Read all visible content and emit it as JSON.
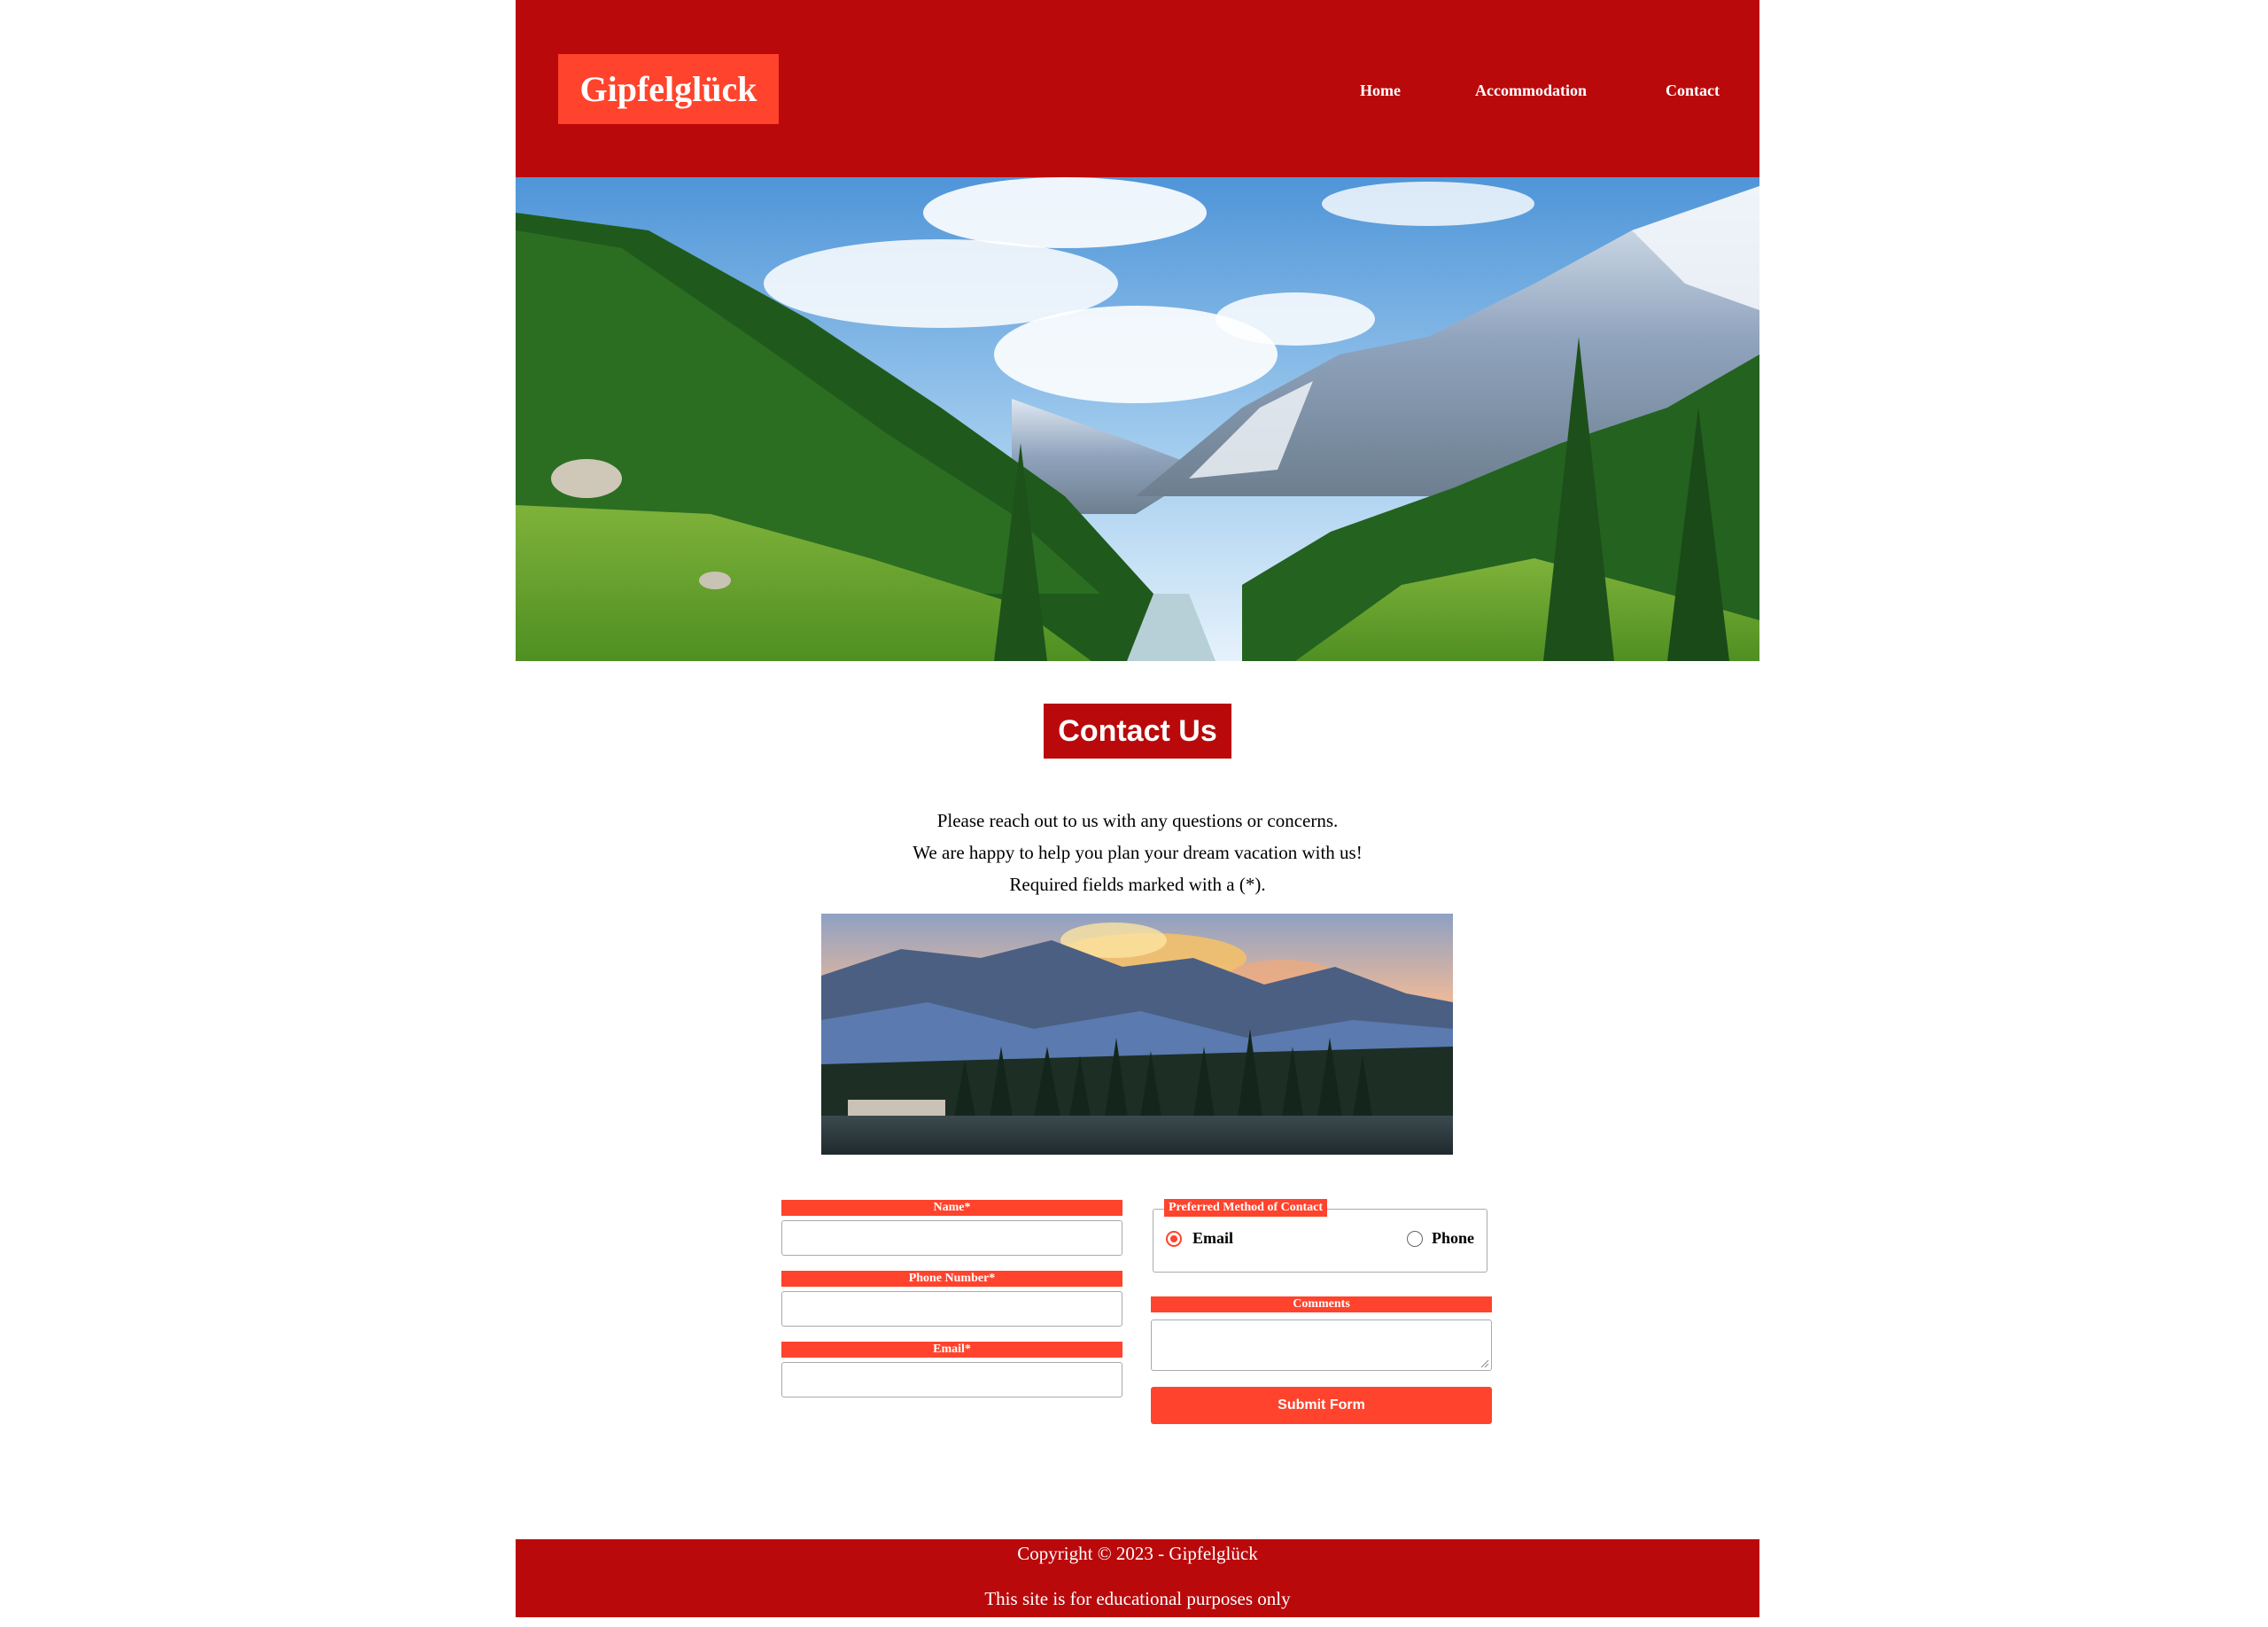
{
  "brand": {
    "name": "Gipfelglück"
  },
  "nav": {
    "home": "Home",
    "accommodation": "Accommodation",
    "contact": "Contact"
  },
  "main": {
    "title": "Contact Us",
    "intro": [
      "Please reach out to us with any questions or concerns.",
      "We are happy to help you plan your dream vacation with us!",
      "Required fields marked with a (*)."
    ]
  },
  "form": {
    "name_label": "Name*",
    "phone_label": "Phone Number*",
    "email_label": "Email*",
    "name_value": "",
    "phone_value": "",
    "email_value": "",
    "preferred_legend": "Preferred Method of Contact",
    "option_email": "Email",
    "option_phone": "Phone",
    "selected_option": "Email",
    "comments_label": "Comments",
    "comments_value": "",
    "submit_label": "Submit Form"
  },
  "footer": {
    "copyright": "Copyright © 2023 - Gipfelglück",
    "note": "This site is for educational purposes only"
  },
  "colors": {
    "brand_red": "#ba090b",
    "accent_orange": "#ff432c"
  }
}
